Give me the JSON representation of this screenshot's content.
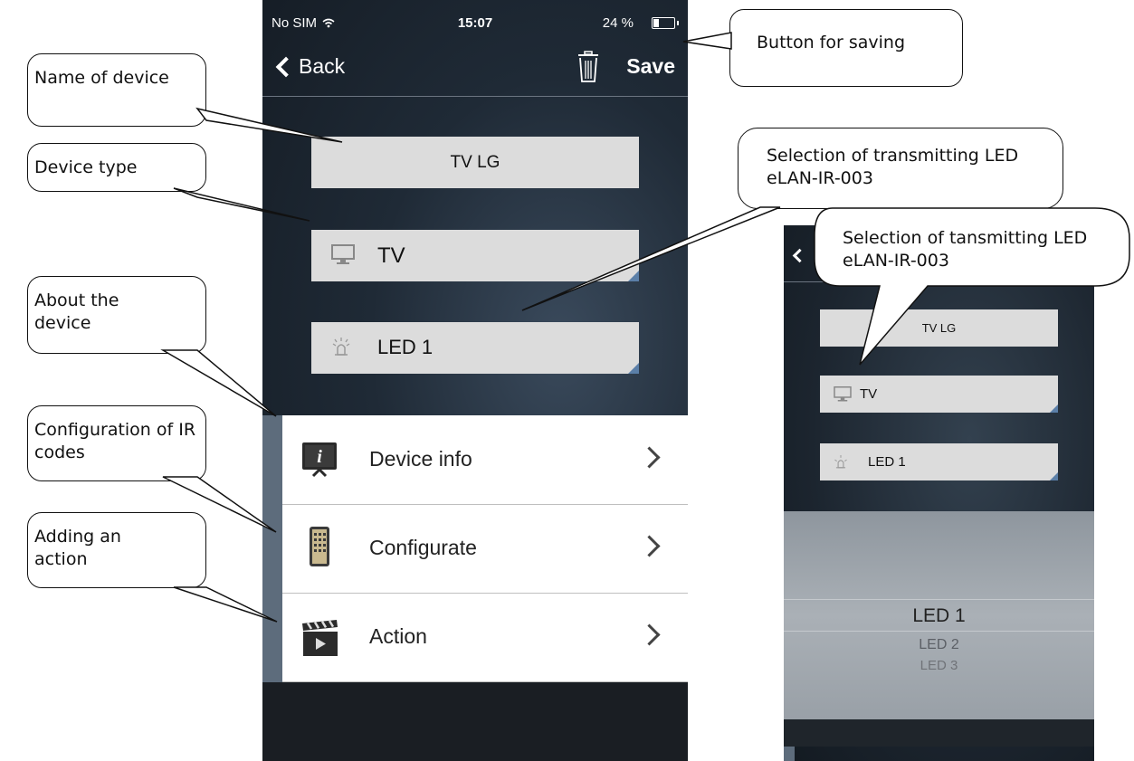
{
  "status_bar": {
    "carrier": "No SIM",
    "time": "15:07",
    "battery": "24 %",
    "battery_level": 0.24
  },
  "nav": {
    "back_label": "Back",
    "save_label": "Save"
  },
  "form": {
    "device_name": "TV LG",
    "device_type": "TV",
    "led": "LED 1"
  },
  "menu": [
    {
      "label": "Device info"
    },
    {
      "label": "Configurate"
    },
    {
      "label": "Action"
    }
  ],
  "second_screen": {
    "device_name": "TV LG",
    "device_type": "TV",
    "led": "LED 1",
    "picker_options": [
      "LED 1",
      "LED 2",
      "LED 3"
    ]
  },
  "callouts": {
    "name_of_device": "Name of device",
    "device_type": "Device type",
    "about_device": "About the device",
    "config_ir": "Configuration of IR codes",
    "adding_action": "Adding an action",
    "button_saving": "Button for saving",
    "selection_transmitting": "Selection of transmitting LED eLAN-IR-003",
    "selection_tansmitting": "Selection of  tansmitting LED eLAN-IR-003"
  },
  "colors": {
    "field_bg": "#dcdcdc",
    "menu_strip": "#5d6c7c",
    "corner_accent": "#5b7fa8"
  }
}
